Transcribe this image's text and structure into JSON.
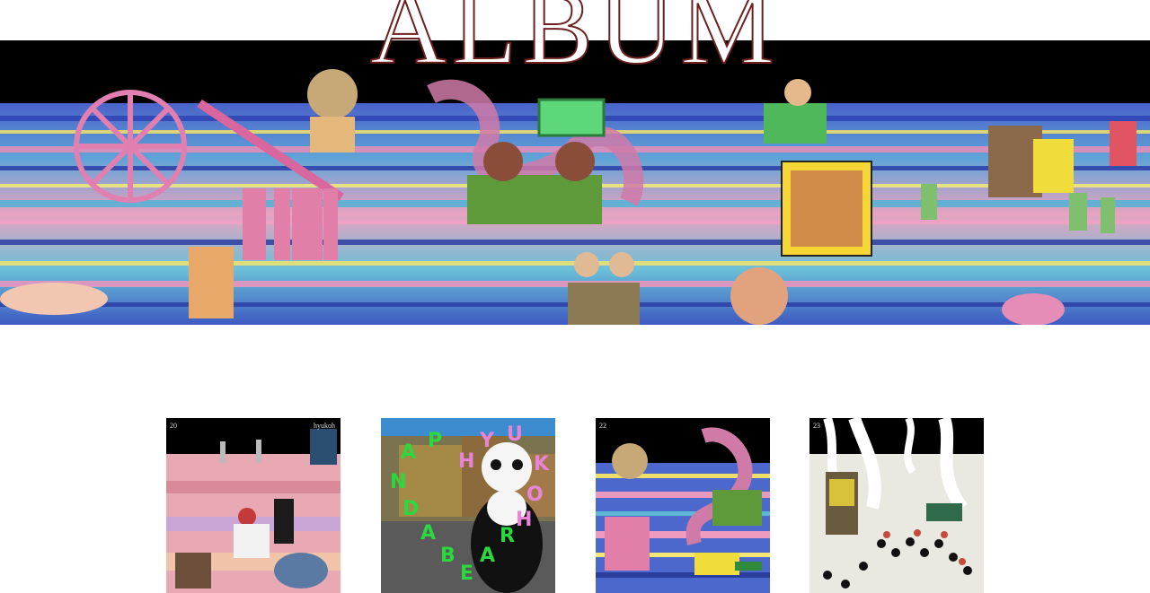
{
  "page": {
    "title": "ALBUM",
    "title_color": "#6b1f1f"
  },
  "hero": {
    "image": "painted-lake-scene",
    "sky_color": "#000000"
  },
  "albums": [
    {
      "number": "20",
      "artist": "hyukoh",
      "cover": "pink-desert-painting"
    },
    {
      "letters": [
        "P",
        "A",
        "N",
        "D",
        "A",
        "B",
        "E",
        "A",
        "R",
        "H",
        "Y",
        "U",
        "K",
        "O",
        "H"
      ],
      "cover": "panda-bear-city"
    },
    {
      "number": "22",
      "cover": "lake-detail-painting"
    },
    {
      "number": "23",
      "cover": "snow-forest-painting"
    }
  ]
}
